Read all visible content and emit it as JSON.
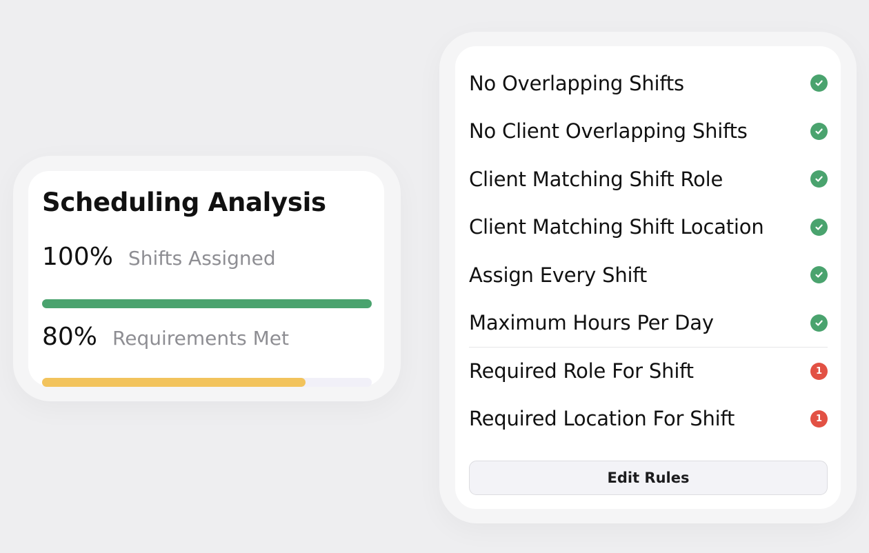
{
  "analysis": {
    "title": "Scheduling Analysis",
    "metrics": [
      {
        "percent_label": "100%",
        "label": "Shifts Assigned",
        "progress": 1.0,
        "color": "#4aa36e"
      },
      {
        "percent_label": "80%",
        "label": "Requirements Met",
        "progress": 0.8,
        "color": "#f2c35c"
      }
    ]
  },
  "rules": {
    "items": [
      {
        "label": "No Overlapping Shifts",
        "status": "ok",
        "icon": "check-circle-icon"
      },
      {
        "label": "No Client Overlapping Shifts",
        "status": "ok",
        "icon": "check-circle-icon"
      },
      {
        "label": "Client Matching Shift Role",
        "status": "ok",
        "icon": "check-circle-icon"
      },
      {
        "label": "Client Matching Shift Location",
        "status": "ok",
        "icon": "check-circle-icon"
      },
      {
        "label": "Assign Every Shift",
        "status": "ok",
        "icon": "check-circle-icon"
      },
      {
        "label": "Maximum Hours Per Day",
        "status": "ok",
        "icon": "check-circle-icon"
      },
      {
        "label": "Required Role For Shift",
        "status": "error",
        "count": "1",
        "icon": "issue-count-badge-icon"
      },
      {
        "label": "Required Location For Shift",
        "status": "error",
        "count": "1",
        "icon": "issue-count-badge-icon"
      }
    ],
    "edit_button_label": "Edit Rules"
  },
  "colors": {
    "ok": "#4aa36e",
    "error": "#e25144",
    "warning": "#f2c35c"
  }
}
